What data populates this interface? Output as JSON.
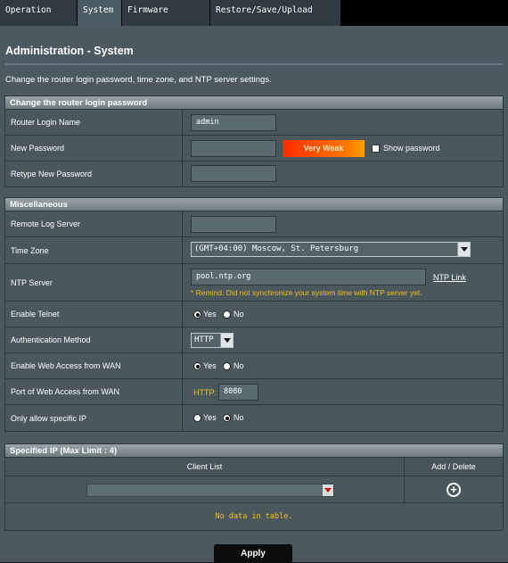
{
  "tabs": [
    {
      "label": "Operation Mode"
    },
    {
      "label": "System"
    },
    {
      "label": "Firmware Upgrade"
    },
    {
      "label": "Restore/Save/Upload Setting"
    }
  ],
  "page": {
    "title": "Administration - System",
    "description": "Change the router login password, time zone, and NTP server settings."
  },
  "login_section": {
    "header": "Change the router login password",
    "login_name_label": "Router Login Name",
    "login_name_value": "admin",
    "new_password_label": "New Password",
    "new_password_value": "",
    "strength_label": "Very Weak",
    "show_password_label": "Show password",
    "retype_password_label": "Retype New Password",
    "retype_password_value": ""
  },
  "misc_section": {
    "header": "Miscellaneous",
    "remote_log_label": "Remote Log Server",
    "remote_log_value": "",
    "time_zone_label": "Time Zone",
    "time_zone_value": "(GMT+04:00) Moscow, St. Petersburg",
    "ntp_label": "NTP Server",
    "ntp_value": "pool.ntp.org",
    "ntp_link": "NTP Link",
    "ntp_remind": "* Remind: Did not synchronize your system time with NTP server yet.",
    "telnet_label": "Enable Telnet",
    "auth_label": "Authentication Method",
    "auth_value": "HTTP",
    "wan_access_label": "Enable Web Access from WAN",
    "wan_port_label": "Port of Web Access from WAN",
    "wan_port_prefix": "HTTP:",
    "wan_port_value": "8080",
    "specific_ip_label": "Only allow specific IP",
    "yes": "Yes",
    "no": "No",
    "telnet_selected": "Yes",
    "wan_access_selected": "Yes",
    "specific_ip_selected": "No"
  },
  "specified_ip": {
    "header": "Specified IP (Max Limit : 4)",
    "col_client": "Client List",
    "col_action": "Add / Delete",
    "empty_text": "No data in table."
  },
  "apply_label": "Apply",
  "colors": {
    "panel": "#4c5960",
    "strength_gradient_start": "#ff2a00",
    "strength_gradient_end": "#ff9f00",
    "remind_text": "#f0c020"
  }
}
